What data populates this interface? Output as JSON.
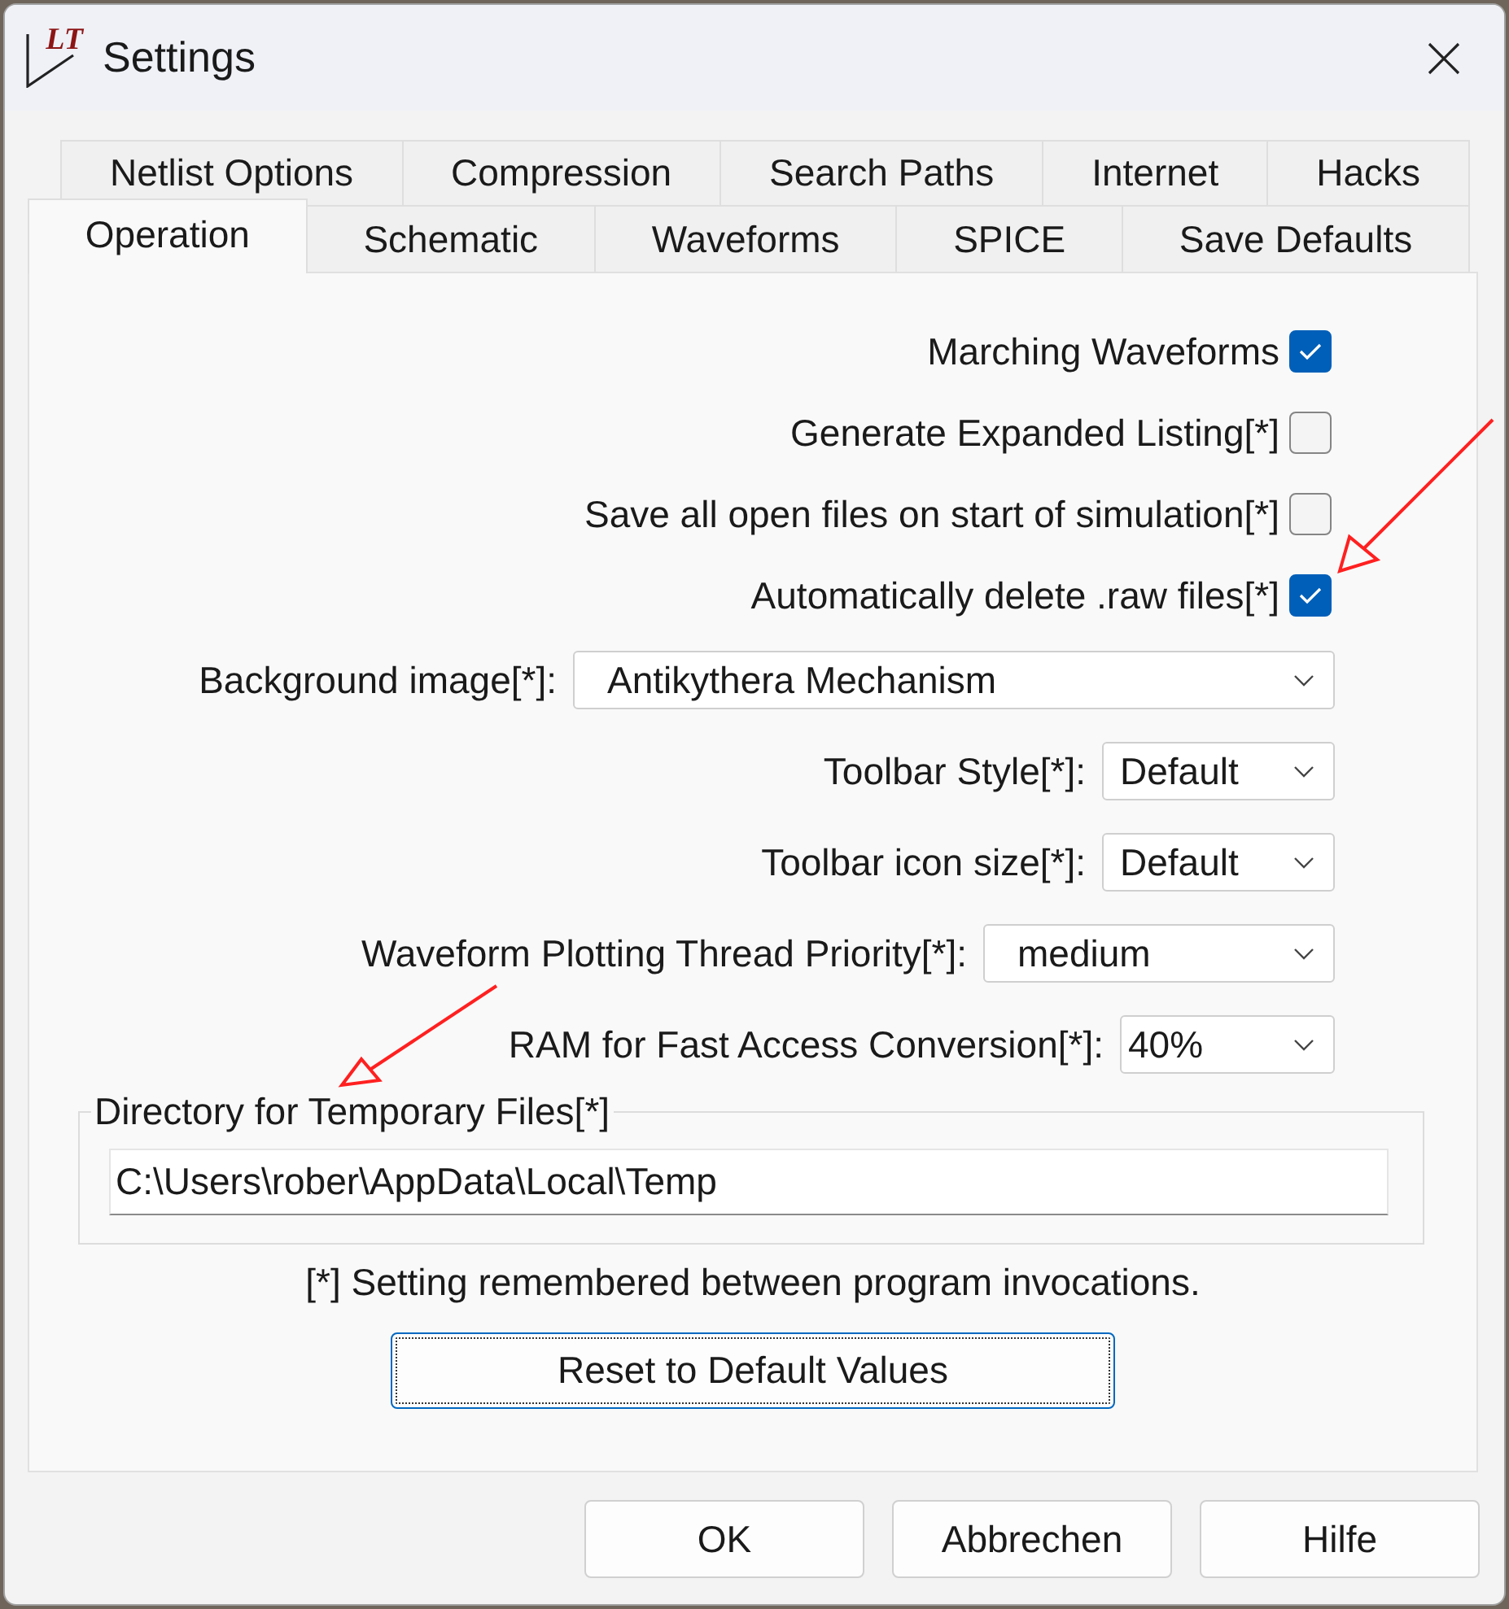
{
  "window": {
    "logo_text": "LT",
    "title": "Settings"
  },
  "tab_rows": [
    {
      "tabs": [
        {
          "label": "Netlist Options",
          "selected": false
        },
        {
          "label": "Compression",
          "selected": false
        },
        {
          "label": "Search Paths",
          "selected": false
        },
        {
          "label": "Internet",
          "selected": false
        },
        {
          "label": "Hacks",
          "selected": false
        }
      ]
    },
    {
      "tabs": [
        {
          "label": "Operation",
          "selected": true
        },
        {
          "label": "Schematic",
          "selected": false
        },
        {
          "label": "Waveforms",
          "selected": false
        },
        {
          "label": "SPICE",
          "selected": false
        },
        {
          "label": "Save Defaults",
          "selected": false
        }
      ]
    }
  ],
  "options": [
    {
      "label": "Marching Waveforms",
      "checked": true
    },
    {
      "label": "Generate Expanded Listing[*]",
      "checked": false
    },
    {
      "label": "Save all open files on start of simulation[*]",
      "checked": false
    },
    {
      "label": "Automatically delete .raw files[*]",
      "checked": true
    }
  ],
  "dropdowns": [
    {
      "label": "Background image[*]:",
      "value": "Antikythera Mechanism"
    },
    {
      "label": "Toolbar Style[*]:",
      "value": "Default"
    },
    {
      "label": "Toolbar icon size[*]:",
      "value": "Default"
    },
    {
      "label": "Waveform Plotting Thread Priority[*]:",
      "value": "medium"
    },
    {
      "label": "RAM for Fast Access Conversion[*]:",
      "value": "40%"
    }
  ],
  "temp_directory": {
    "label": "Directory for Temporary Files[*]",
    "value": "C:\\Users\\rober\\AppData\\Local\\Temp"
  },
  "note": "[*] Setting remembered between program invocations.",
  "reset_button": {
    "label": "Reset to Default Values",
    "focused": true
  },
  "buttons": [
    "OK",
    "Abbrechen",
    "Hilfe"
  ]
}
